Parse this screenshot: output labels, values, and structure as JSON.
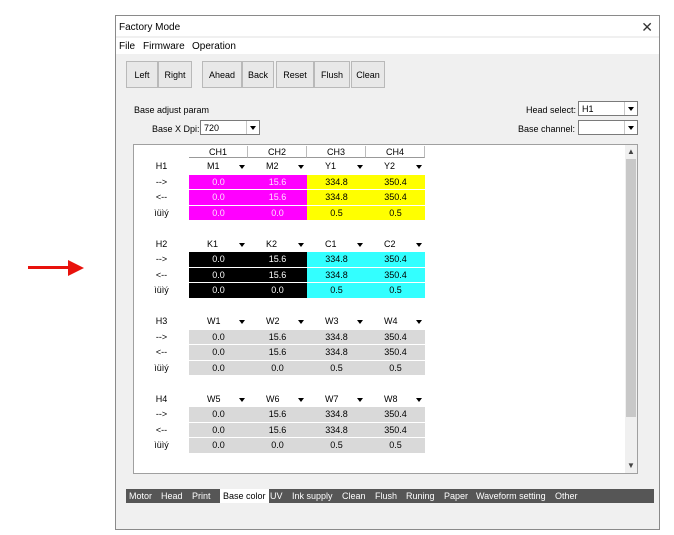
{
  "window": {
    "title": "Factory Mode",
    "close_icon": "close-icon"
  },
  "menu": [
    "File",
    "Firmware",
    "Operation"
  ],
  "toolbar": [
    "Left",
    "Right",
    "Ahead",
    "Back",
    "Reset",
    "Flush",
    "Clean"
  ],
  "params": {
    "section_label": "Base adjust param",
    "dpi_label": "Base X Dpi:",
    "dpi_value": "720",
    "head_select_label": "Head select:",
    "head_select_value": "H1",
    "base_channel_label": "Base channel:",
    "base_channel_value": ""
  },
  "grid": {
    "columns": [
      "CH1",
      "CH2",
      "CH3",
      "CH4"
    ],
    "colors": {
      "magenta": "#ff00ff",
      "yellow": "#ffff00",
      "black": "#000000",
      "cyan": "#33ffff",
      "gray": "#d9d9d9"
    },
    "groups": [
      {
        "head": "H1",
        "channels": [
          "M1",
          "M2",
          "Y1",
          "Y2"
        ],
        "channel_colors": [
          "magenta",
          "magenta",
          "yellow",
          "yellow"
        ],
        "rows": [
          {
            "label": "-->",
            "values": [
              "0.0",
              "15.6",
              "334.8",
              "350.4"
            ]
          },
          {
            "label": "<--",
            "values": [
              "0.0",
              "15.6",
              "334.8",
              "350.4"
            ]
          },
          {
            "label": "ìüìý",
            "values": [
              "0.0",
              "0.0",
              "0.5",
              "0.5"
            ]
          }
        ]
      },
      {
        "head": "H2",
        "channels": [
          "K1",
          "K2",
          "C1",
          "C2"
        ],
        "channel_colors": [
          "black",
          "black",
          "cyan",
          "cyan"
        ],
        "rows": [
          {
            "label": "-->",
            "values": [
              "0.0",
              "15.6",
              "334.8",
              "350.4"
            ]
          },
          {
            "label": "<--",
            "values": [
              "0.0",
              "15.6",
              "334.8",
              "350.4"
            ]
          },
          {
            "label": "ìüìý",
            "values": [
              "0.0",
              "0.0",
              "0.5",
              "0.5"
            ]
          }
        ]
      },
      {
        "head": "H3",
        "channels": [
          "W1",
          "W2",
          "W3",
          "W4"
        ],
        "channel_colors": [
          "gray",
          "gray",
          "gray",
          "gray"
        ],
        "rows": [
          {
            "label": "-->",
            "values": [
              "0.0",
              "15.6",
              "334.8",
              "350.4"
            ]
          },
          {
            "label": "<--",
            "values": [
              "0.0",
              "15.6",
              "334.8",
              "350.4"
            ]
          },
          {
            "label": "ìüìý",
            "values": [
              "0.0",
              "0.0",
              "0.5",
              "0.5"
            ]
          }
        ]
      },
      {
        "head": "H4",
        "channels": [
          "W5",
          "W6",
          "W7",
          "W8"
        ],
        "channel_colors": [
          "gray",
          "gray",
          "gray",
          "gray"
        ],
        "rows": [
          {
            "label": "-->",
            "values": [
              "0.0",
              "15.6",
              "334.8",
              "350.4"
            ]
          },
          {
            "label": "<--",
            "values": [
              "0.0",
              "15.6",
              "334.8",
              "350.4"
            ]
          },
          {
            "label": "ìüìý",
            "values": [
              "0.0",
              "0.0",
              "0.5",
              "0.5"
            ]
          }
        ]
      }
    ]
  },
  "tabs": [
    "Motor",
    "Head",
    "Print",
    "Base color",
    "UV",
    "Ink supply",
    "Clean",
    "Flush",
    "Runing",
    "Paper",
    "Waveform setting",
    "Other"
  ],
  "active_tab": "Base color"
}
